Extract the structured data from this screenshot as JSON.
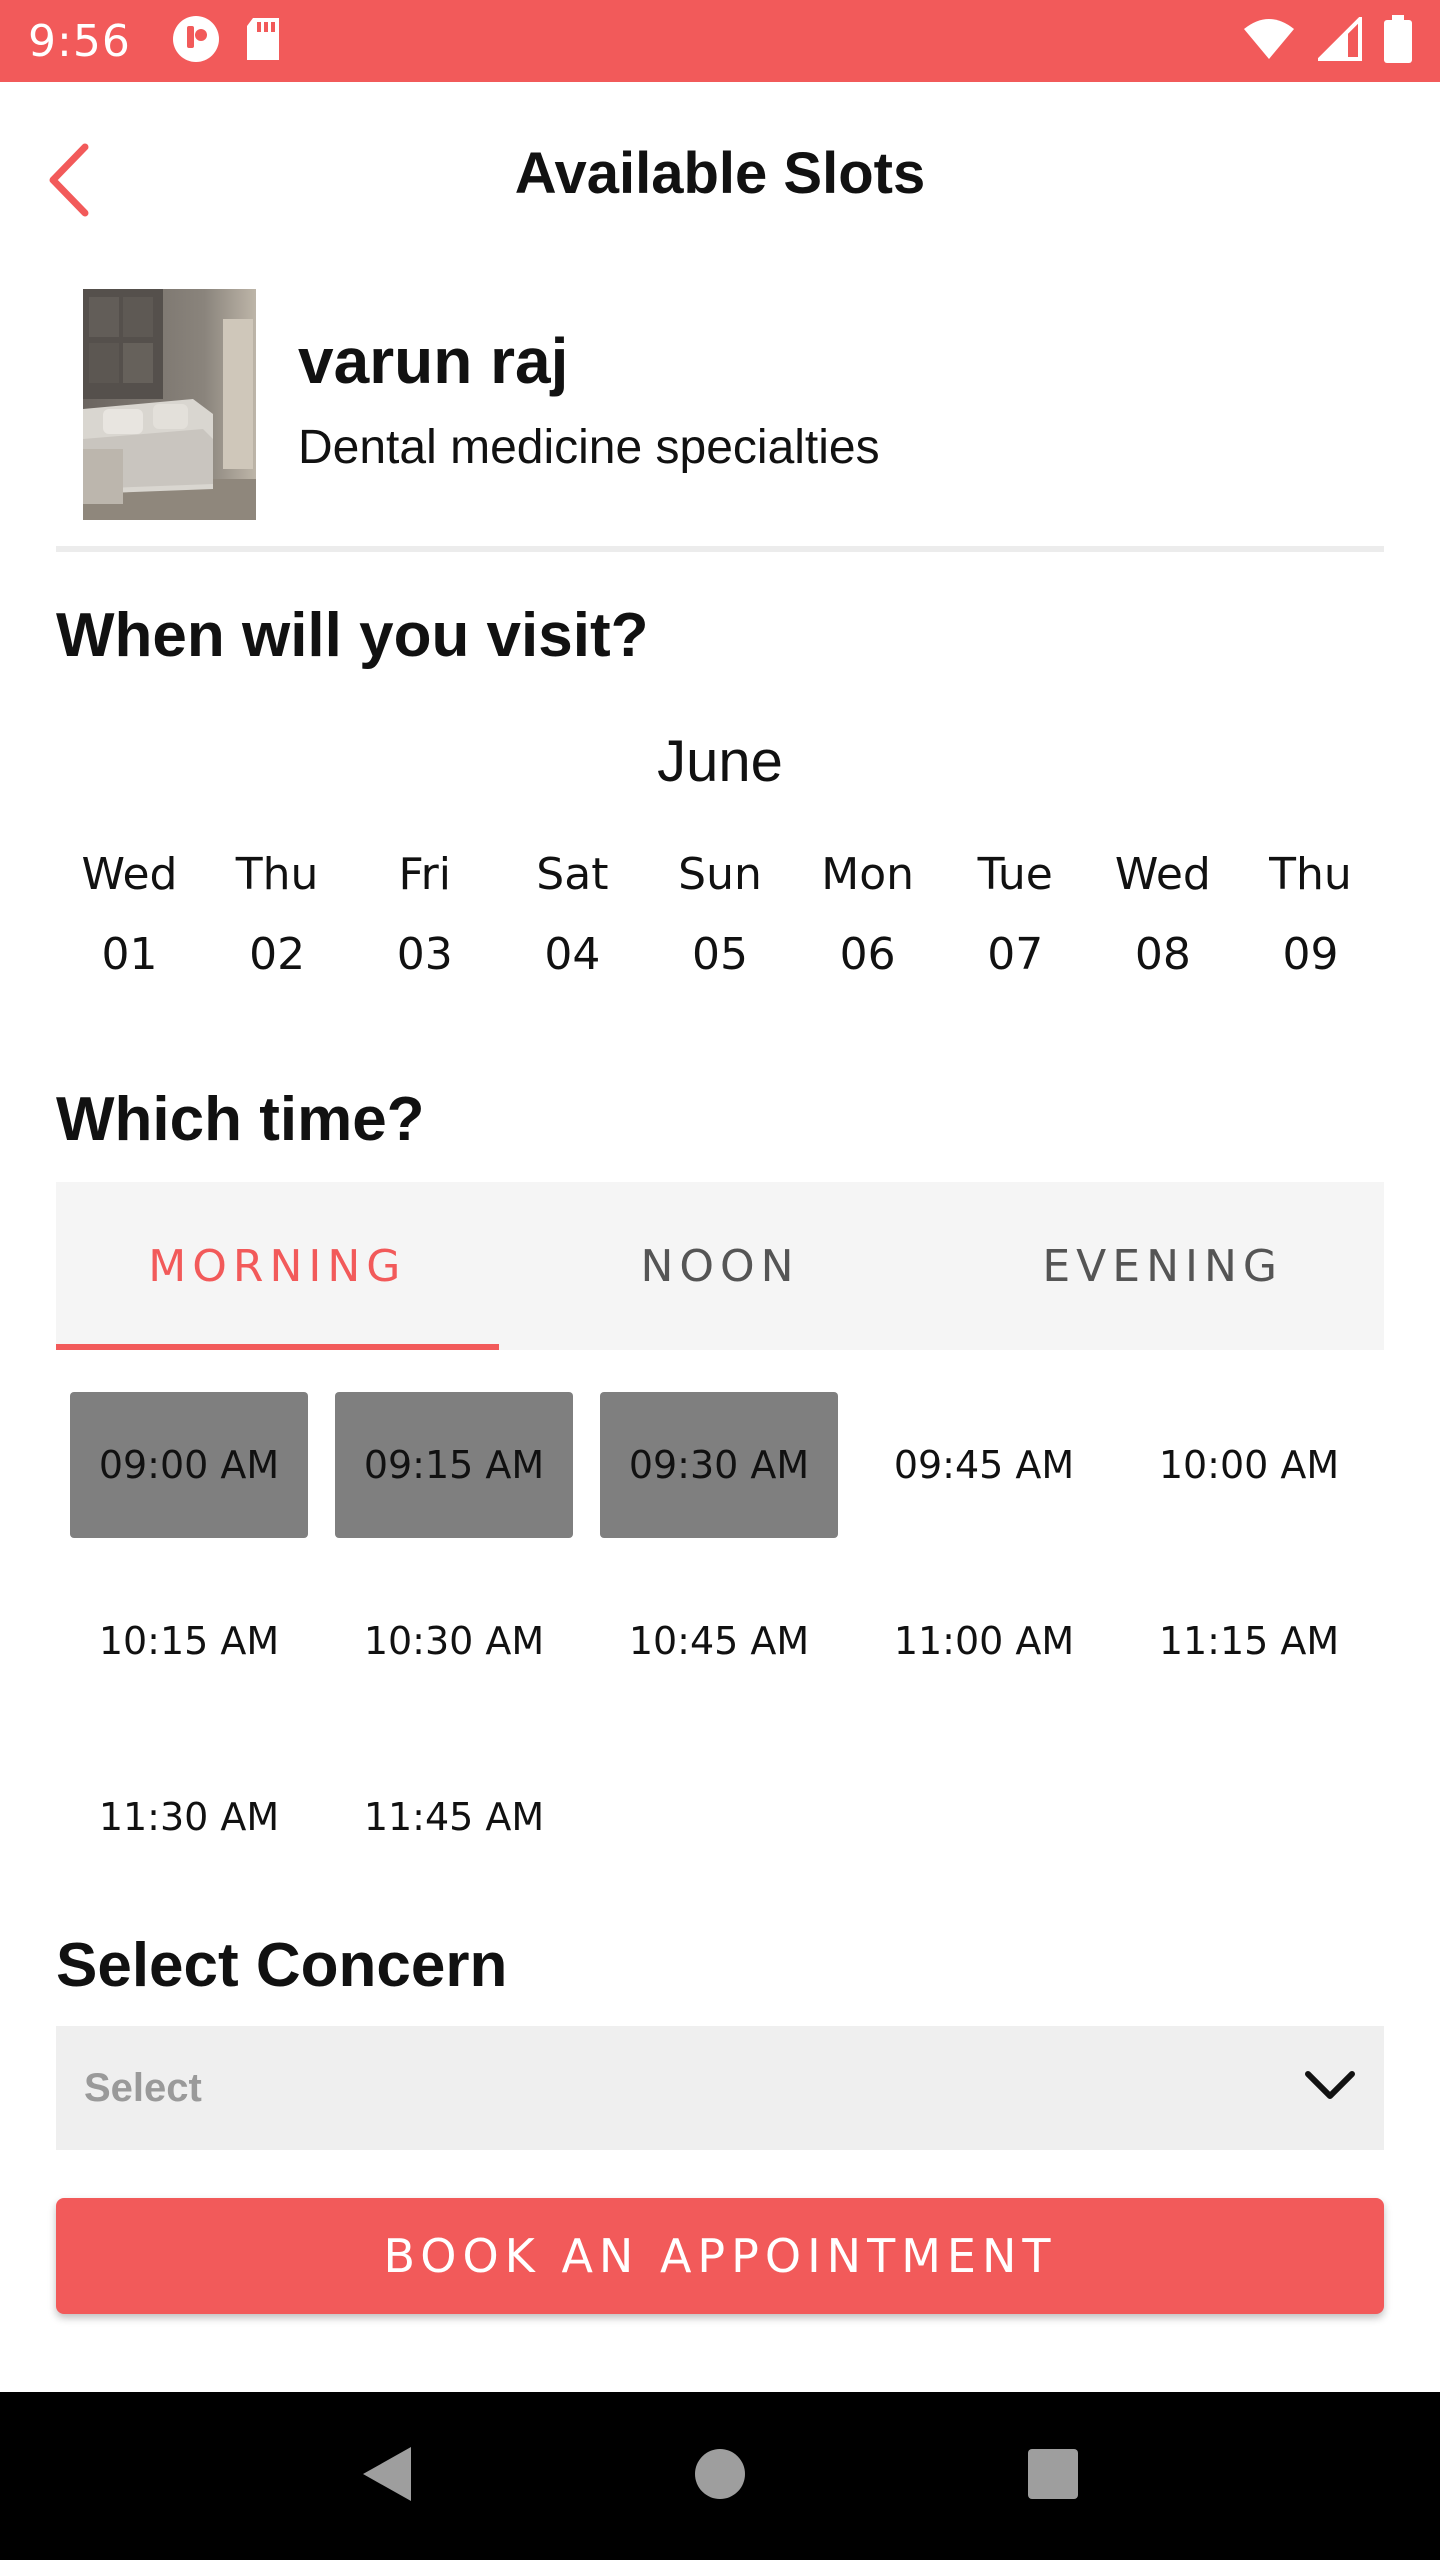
{
  "status_bar": {
    "time": "9:56",
    "left_icons": [
      "notification-app-icon",
      "sd-card-icon"
    ],
    "right_icons": [
      "wifi-icon",
      "cellular-signal-icon",
      "battery-icon"
    ]
  },
  "header": {
    "title": "Available Slots",
    "back_icon": "chevron-left-icon"
  },
  "doctor": {
    "name": "varun raj",
    "specialty": "Dental medicine specialties"
  },
  "visit": {
    "heading": "When will you visit?",
    "month": "June",
    "dates": [
      {
        "day": "Wed",
        "num": "01"
      },
      {
        "day": "Thu",
        "num": "02"
      },
      {
        "day": "Fri",
        "num": "03"
      },
      {
        "day": "Sat",
        "num": "04"
      },
      {
        "day": "Sun",
        "num": "05"
      },
      {
        "day": "Mon",
        "num": "06"
      },
      {
        "day": "Tue",
        "num": "07"
      },
      {
        "day": "Wed",
        "num": "08"
      },
      {
        "day": "Thu",
        "num": "09"
      }
    ]
  },
  "time": {
    "heading": "Which time?",
    "tabs": [
      {
        "label": "MORNING",
        "active": true
      },
      {
        "label": "NOON",
        "active": false
      },
      {
        "label": "EVENING",
        "active": false
      }
    ],
    "slots": [
      {
        "label": "09:00 AM",
        "selected": true
      },
      {
        "label": "09:15 AM",
        "selected": true
      },
      {
        "label": "09:30 AM",
        "selected": true
      },
      {
        "label": "09:45 AM",
        "selected": false
      },
      {
        "label": "10:00 AM",
        "selected": false
      },
      {
        "label": "10:15 AM",
        "selected": false
      },
      {
        "label": "10:30 AM",
        "selected": false
      },
      {
        "label": "10:45 AM",
        "selected": false
      },
      {
        "label": "11:00 AM",
        "selected": false
      },
      {
        "label": "11:15 AM",
        "selected": false
      },
      {
        "label": "11:30 AM",
        "selected": false
      },
      {
        "label": "11:45 AM",
        "selected": false
      }
    ]
  },
  "concern": {
    "heading": "Select Concern",
    "placeholder": "Select",
    "dropdown_icon": "chevron-down-icon"
  },
  "actions": {
    "book_label": "BOOK AN APPOINTMENT"
  },
  "colors": {
    "accent": "#f25a5a",
    "selected_slot": "#7f7f7f",
    "tab_bg": "#f5f5f5",
    "select_bg": "#efefef"
  },
  "nav_bar": {
    "icons": [
      "back-triangle-icon",
      "home-circle-icon",
      "recents-square-icon"
    ]
  }
}
